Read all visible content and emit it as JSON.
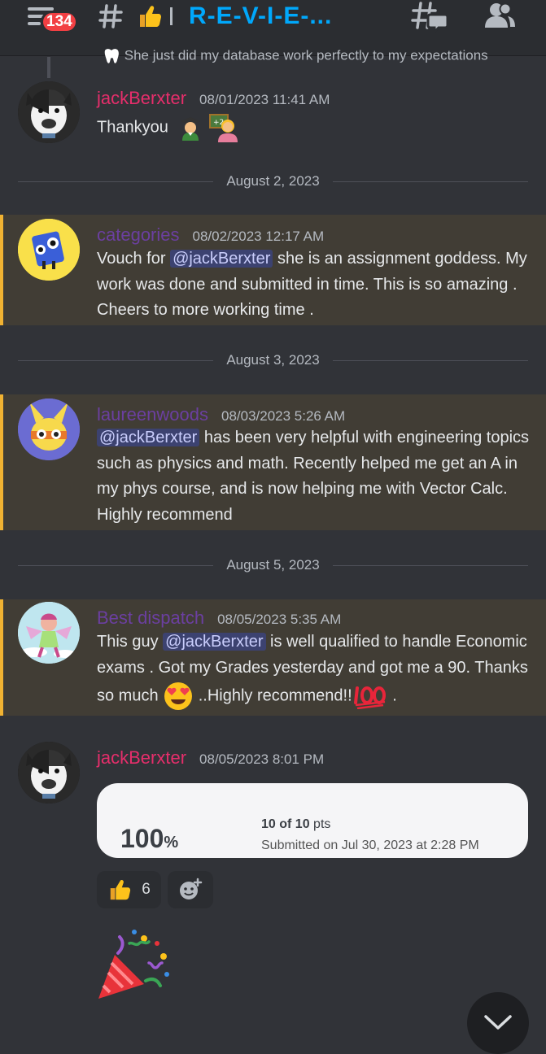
{
  "header": {
    "badge_count": "134",
    "channel_name": "R-E-V-I-E-..."
  },
  "reply_preview": "She just did my database work perfectly to my expectations",
  "messages": [
    {
      "author": "jackBerxter",
      "timestamp": "08/01/2023 11:41 AM",
      "text": "Thankyou",
      "author_color": "#e62e6b"
    },
    {
      "author": "categories",
      "timestamp": "08/02/2023 12:17 AM",
      "pre": "Vouch for ",
      "mention": "@jackBerxter",
      "post": " she is an assignment goddess. My work was done and submitted in time. This is so amazing . Cheers to more working time .",
      "author_color": "#6b3fa0"
    },
    {
      "author": "laureenwoods",
      "timestamp": "08/03/2023 5:26 AM",
      "mention": "@jackBerxter",
      "post": " has been very helpful with engineering topics such as physics and math. Recently helped me get an A in my phys course, and is now helping me with Vector Calc. Highly recommend",
      "author_color": "#6b3fa0"
    },
    {
      "author": "Best dispatch",
      "timestamp": "08/05/2023 5:35 AM",
      "pre": "This guy ",
      "mention": "@jackBerxter",
      "post_a": " is well qualified to handle Economic exams . Got my Grades yesterday  and got me a 90. Thanks so much ",
      "post_b": " ..Highly recommend!!",
      "post_c": " .",
      "author_color": "#6b3fa0"
    },
    {
      "author": "jackBerxter",
      "timestamp": "08/05/2023 8:01 PM",
      "author_color": "#e62e6b"
    }
  ],
  "dividers": [
    "August 2, 2023",
    "August 3, 2023",
    "August 5, 2023"
  ],
  "embed": {
    "score": "100",
    "score_unit": "%",
    "points": "10 of 10",
    "points_unit": "pts",
    "submitted": "Submitted on Jul 30, 2023 at 2:28 PM"
  },
  "reactions": [
    {
      "emoji": "thumbs-up",
      "count": "6"
    }
  ],
  "colors": {
    "accent": "#00a8fc",
    "highlight_bar": "#f0b232",
    "mention_bg": "#3c4270",
    "badge": "#f23f43"
  }
}
